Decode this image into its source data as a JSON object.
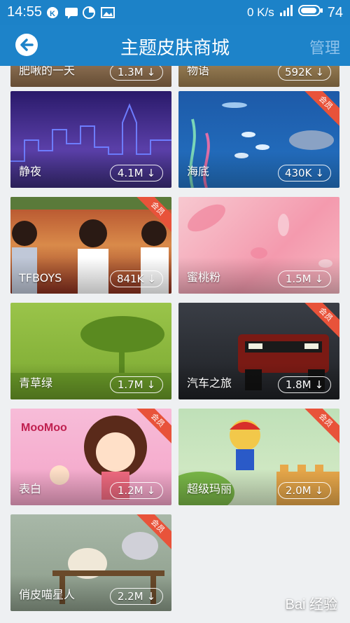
{
  "status": {
    "time": "14:55",
    "speed": "0 K/s",
    "battery_level": "74"
  },
  "header": {
    "title": "主题皮肤商城",
    "manage_label": "管理"
  },
  "partial_row": {
    "left_label": "肥啾的一天",
    "left_size": "1.3M",
    "right_label": "物语",
    "right_size": "592K"
  },
  "themes": [
    {
      "name": "静夜",
      "size": "4.1M",
      "member": false
    },
    {
      "name": "海底",
      "size": "430K",
      "member": true
    },
    {
      "name": "TFBOYS",
      "size": "841K",
      "member": true
    },
    {
      "name": "蜜桃粉",
      "size": "1.5M",
      "member": false
    },
    {
      "name": "青草绿",
      "size": "1.7M",
      "member": false
    },
    {
      "name": "汽车之旅",
      "size": "1.8M",
      "member": true
    },
    {
      "name": "表白",
      "size": "1.2M",
      "member": true
    },
    {
      "name": "超级玛丽",
      "size": "2.0M",
      "member": true
    },
    {
      "name": "俏皮喵星人",
      "size": "2.2M",
      "member": true
    }
  ],
  "member_badge": "会员",
  "watermark": "Bai 经验"
}
